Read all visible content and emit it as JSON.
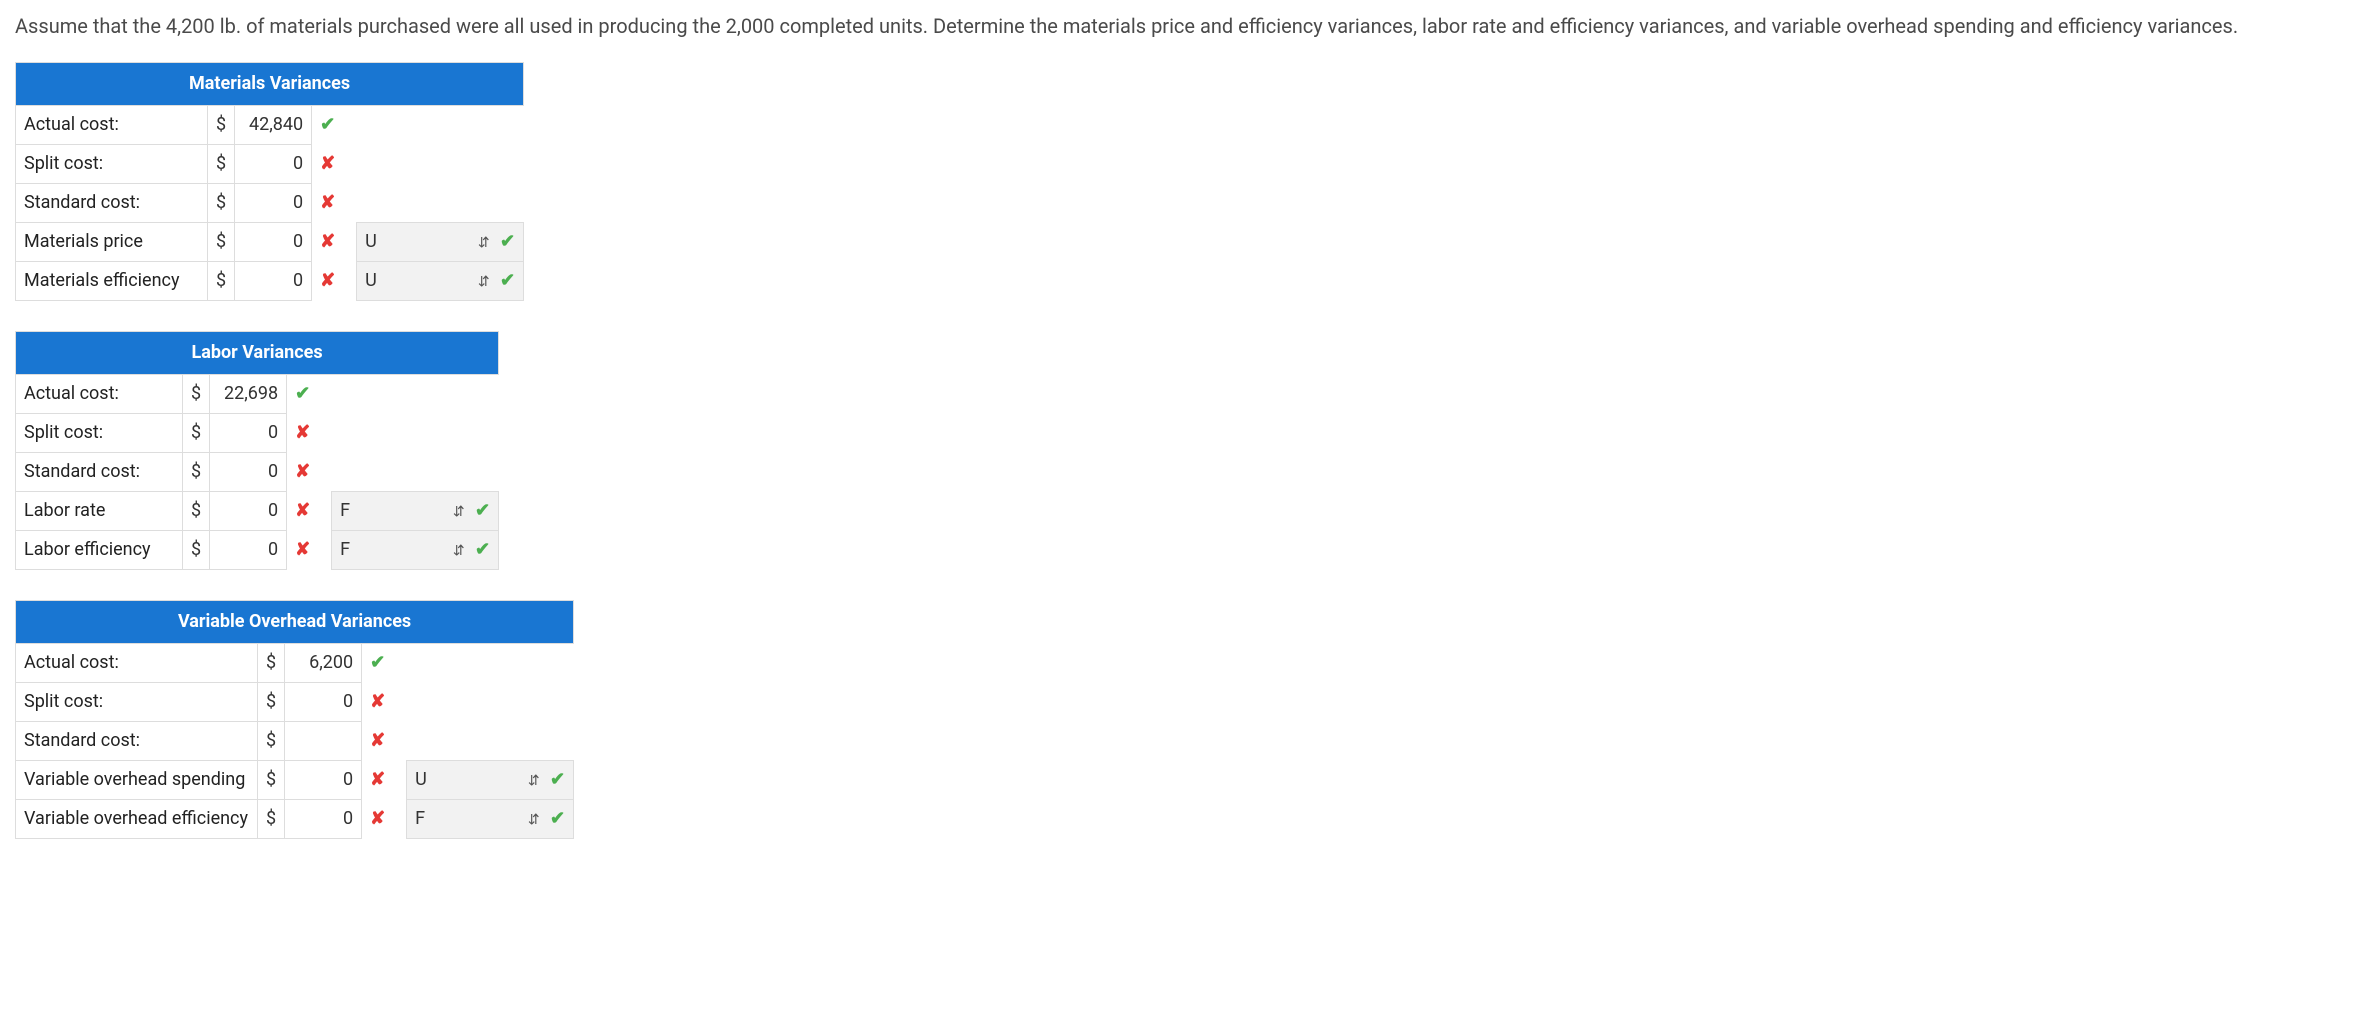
{
  "question": "Assume that the 4,200 lb. of materials purchased were all used in producing the 2,000 completed units. Determine the materials price and efficiency variances, labor rate and efficiency variances, and variable overhead spending and efficiency variances.",
  "tables": {
    "materials": {
      "title": "Materials Variances",
      "rows": {
        "actual": {
          "label": "Actual cost:",
          "value": "42,840",
          "status": "check"
        },
        "split": {
          "label": "Split cost:",
          "value": "0",
          "status": "cross"
        },
        "standard": {
          "label": "Standard cost:",
          "value": "0",
          "status": "cross"
        },
        "price": {
          "label": "Materials price",
          "value": "0",
          "status": "cross",
          "uf": "U",
          "ufstatus": "check"
        },
        "efficiency": {
          "label": "Materials efficiency",
          "value": "0",
          "status": "cross",
          "uf": "U",
          "ufstatus": "check"
        }
      }
    },
    "labor": {
      "title": "Labor Variances",
      "rows": {
        "actual": {
          "label": "Actual cost:",
          "value": "22,698",
          "status": "check"
        },
        "split": {
          "label": "Split cost:",
          "value": "0",
          "status": "cross"
        },
        "standard": {
          "label": "Standard cost:",
          "value": "0",
          "status": "cross"
        },
        "rate": {
          "label": "Labor rate",
          "value": "0",
          "status": "cross",
          "uf": "F",
          "ufstatus": "check"
        },
        "efficiency": {
          "label": "Labor efficiency",
          "value": "0",
          "status": "cross",
          "uf": "F",
          "ufstatus": "check"
        }
      }
    },
    "overhead": {
      "title": "Variable Overhead Variances",
      "rows": {
        "actual": {
          "label": "Actual cost:",
          "value": "6,200",
          "status": "check"
        },
        "split": {
          "label": "Split cost:",
          "value": "0",
          "status": "cross"
        },
        "standard": {
          "label": "Standard cost:",
          "value": "",
          "status": "cross"
        },
        "spending": {
          "label": "Variable overhead spending",
          "value": "0",
          "status": "cross",
          "uf": "U",
          "ufstatus": "check"
        },
        "efficiency": {
          "label": "Variable overhead efficiency",
          "value": "0",
          "status": "cross",
          "uf": "F",
          "ufstatus": "check"
        }
      }
    }
  },
  "symbols": {
    "check": "✔",
    "cross": "✘",
    "sort": "⇵",
    "dollar": "$"
  }
}
